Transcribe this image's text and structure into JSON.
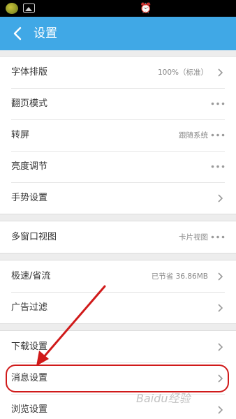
{
  "statusbar": {
    "icons": [
      "app-icon",
      "image-icon",
      "alarm-icon"
    ]
  },
  "header": {
    "title": "设置",
    "back_icon": "chevron-left-icon",
    "color": "#40a8e6"
  },
  "groups": [
    [
      {
        "label": "字体排版",
        "value": "100%（标准）",
        "action": "chevron"
      },
      {
        "label": "翻页模式",
        "value": "",
        "action": "dots"
      },
      {
        "label": "转屏",
        "value": "跟随系统",
        "action": "dots"
      },
      {
        "label": "亮度调节",
        "value": "",
        "action": "dots"
      },
      {
        "label": "手势设置",
        "value": "",
        "action": "chevron"
      }
    ],
    [
      {
        "label": "多窗口视图",
        "value": "卡片视图",
        "action": "dots"
      }
    ],
    [
      {
        "label": "极速/省流",
        "value": "已节省 36.86MB",
        "action": "chevron"
      },
      {
        "label": "广告过滤",
        "value": "",
        "action": "chevron"
      }
    ],
    [
      {
        "label": "下载设置",
        "value": "",
        "action": "chevron"
      },
      {
        "label": "消息设置",
        "value": "",
        "action": "chevron"
      },
      {
        "label": "浏览设置",
        "value": "",
        "action": "chevron"
      }
    ]
  ],
  "annotation": {
    "arrow_color": "#d01a1a",
    "highlight_color": "#d01a1a"
  },
  "watermark": {
    "text": "Baidu经验"
  }
}
